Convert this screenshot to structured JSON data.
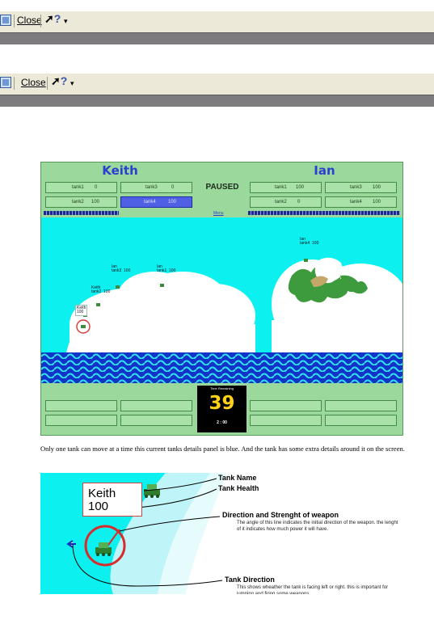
{
  "toolbar_top": {
    "close_label": "Close",
    "help_symbol": "?",
    "dropdown_symbol": "▾"
  },
  "toolbar_second": {
    "close_label": "Close",
    "help_symbol": "?",
    "dropdown_symbol": "▾"
  },
  "game": {
    "player1_name": "Keith",
    "player2_name": "Ian",
    "status": "PAUSED",
    "menu_link": "Menu",
    "p1_tanks": [
      {
        "name": "tank1",
        "health": "0"
      },
      {
        "name": "tank3",
        "health": "0"
      },
      {
        "name": "tank2",
        "health": "100"
      },
      {
        "name": "tank4",
        "health": "100"
      }
    ],
    "p2_tanks": [
      {
        "name": "tank1",
        "health": "100"
      },
      {
        "name": "tank3",
        "health": "100"
      },
      {
        "name": "tank2",
        "health": "0"
      },
      {
        "name": "tank4",
        "health": "100"
      }
    ],
    "timer_label": "Time Remaining",
    "timer_value": "39",
    "timer_sub": "2 : 00",
    "tags": {
      "ian_tank4": "Ian\ntank4  100",
      "ian_tank3": "Ian\ntank3  100",
      "ian_tank1": "Ian\ntank1  100",
      "keith_tank2": "Keith\ntank2  100",
      "keith_active": "Keith\n100"
    },
    "colors": {
      "hud_green": "#9bd89b",
      "sky": "#0cf0f0",
      "water": "#1234c8",
      "active_panel": "#5060e4",
      "player_name": "#2d3fd0"
    }
  },
  "caption": "Only one tank can move at a time this current tanks details panel is blue. And the tank has some extra details around it on the screen.",
  "detail": {
    "box_name": "Keith",
    "box_health": "100",
    "label_name": "Tank Name",
    "label_health": "Tank Health",
    "label_weapon": "Direction and Strenght of weapon",
    "desc_weapon": "The angle of this line indicates the initial direction of the weapon. the lenght of it indicates how much power it will have.",
    "label_direction": "Tank Direction",
    "desc_direction": "This shows wheather the tank is facing left or right. this is important for jumping and firing some weapons."
  }
}
